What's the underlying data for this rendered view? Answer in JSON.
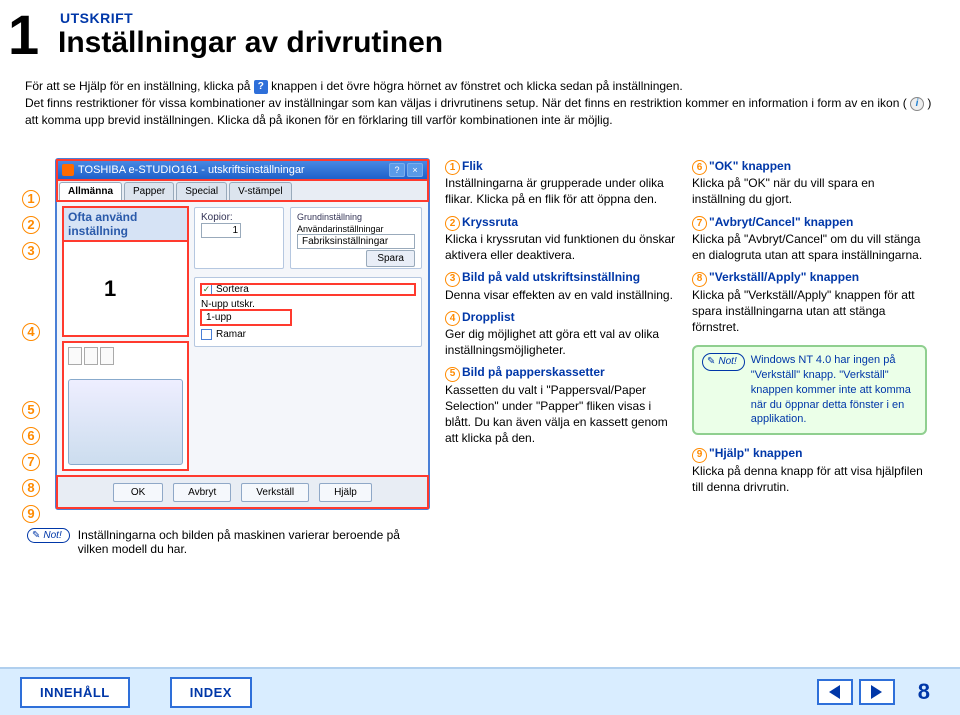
{
  "chapter_number": "1",
  "pre_title": "UTSKRIFT",
  "title": "Inställningar av drivrutinen",
  "intro_1a": "För att se Hjälp för en inställning, klicka på ",
  "intro_1b": " knappen i det övre högra hörnet av fönstret och klicka sedan på inställningen.",
  "intro_2a": "Det finns restriktioner för vissa kombinationer av inställningar som kan väljas i drivrutinens setup. När det finns en restriktion kommer en information i form av en ikon ( ",
  "intro_2b": " ) att komma upp brevid inställningen. Klicka då på ikonen för en förklaring till varför kombinationen inte är möjlig.",
  "callout_labels": [
    "1",
    "2",
    "3",
    "4",
    "5",
    "6",
    "7",
    "8",
    "9"
  ],
  "screenshot": {
    "titlebar": "TOSHIBA e-STUDIO161 - utskriftsinställningar",
    "help_glyph": "?",
    "close_glyph": "×",
    "tabs": [
      "Allmänna",
      "Papper",
      "Special",
      "V-stämpel"
    ],
    "ofta_head": "Ofta använd inställning",
    "big1": "1",
    "kopior_label": "Kopior:",
    "kopior_value": "1",
    "grund_legend": "Grundinställning",
    "anvandar_legend": "Användarinställningar",
    "anvandar_value": "Fabriksinställningar",
    "spara": "Spara",
    "sortera": "Sortera",
    "nupp_label": "N-upp utskr.",
    "nupp_value": "1-upp",
    "ramar": "Ramar",
    "actions": [
      "OK",
      "Avbryt",
      "Verkställ",
      "Hjälp"
    ]
  },
  "note_badge": "Not!",
  "note1_text": "Inställningarna och bilden på maskinen varierar beroende på vilken modell du har.",
  "items": {
    "i1_t": "Flik",
    "i1_b": "Inställningarna är grupperade under olika flikar. Klicka på en flik för att öppna den.",
    "i2_t": "Kryssruta",
    "i2_b": "Klicka i kryssrutan vid funktionen du önskar aktivera eller deaktivera.",
    "i3_t": "Bild på vald utskriftsinställning",
    "i3_b": "Denna visar effekten av en vald inställning.",
    "i4_t": "Dropplist",
    "i4_b": "Ger dig möjlighet att göra ett val av olika inställningsmöjligheter.",
    "i5_t": "Bild på papperskassetter",
    "i5_b": "Kassetten du valt i \"Pappersval/Paper Selection\" under \"Papper\" fliken visas i blått. Du kan även välja en kassett genom att klicka på den.",
    "i6_t": "\"OK\" knappen",
    "i6_b": "Klicka på \"OK\" när du vill spara en inställning du gjort.",
    "i7_t": "\"Avbryt/Cancel\" knappen",
    "i7_b": "Klicka på \"Avbryt/Cancel\" om du vill stänga en dialogruta utan att spara inställningarna.",
    "i8_t": "\"Verkställ/Apply\" knappen",
    "i8_b": "Klicka på \"Verkställ/Apply\" knappen för att spara inställningarna utan att stänga förnstret.",
    "i9_t": "\"Hjälp\" knappen",
    "i9_b": "Klicka på denna knapp för att visa hjälpfilen till denna drivrutin."
  },
  "green_note": "Windows NT 4.0 har ingen på \"Verkställ\" knapp. \"Verkställ\" knappen kommer inte att komma när du öppnar detta fönster i en applikation.",
  "footer": {
    "btn1": "INNEHÅLL",
    "btn2": "INDEX",
    "page": "8"
  }
}
